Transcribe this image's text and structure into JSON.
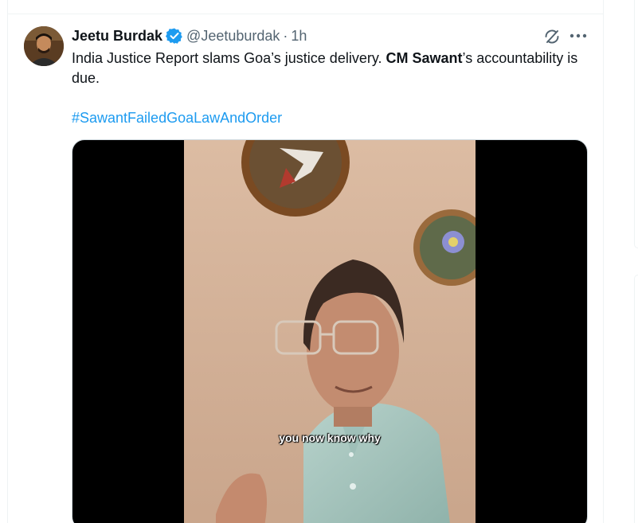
{
  "tweet": {
    "author": {
      "display_name": "Jeetu Burdak",
      "handle": "@Jeetuburdak",
      "verified": true,
      "verified_icon": "verified-badge-icon"
    },
    "separator": "·",
    "time": "1h",
    "text": {
      "part1": "India Justice Report slams Goa’s justice delivery. ",
      "bold": "CM Sawant",
      "part2": "’s accountability is due."
    },
    "hashtag": "#SawantFailedGoaLawAndOrder",
    "video": {
      "caption": "you now know why"
    },
    "actions": {
      "grok_icon": "grok-icon",
      "more_icon": "more-horizontal-icon"
    }
  },
  "colors": {
    "accent": "#1d9bf0",
    "text_primary": "#0f1419",
    "text_secondary": "#536471",
    "border": "#eff3f4"
  }
}
